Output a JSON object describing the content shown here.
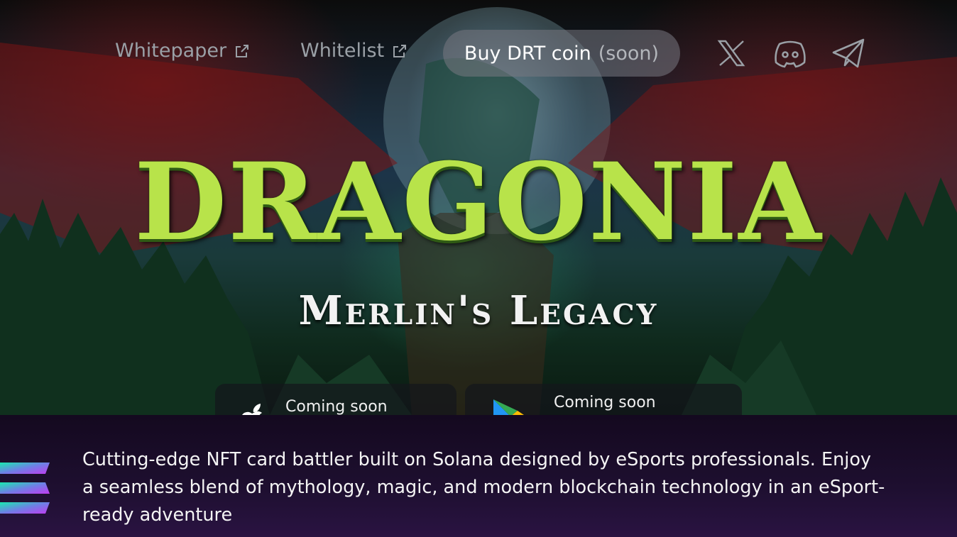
{
  "nav": {
    "whitepaper_label": "Whitepaper",
    "whitelist_label": "Whitelist",
    "buy_label": "Buy DRT coin",
    "buy_soon": "(soon)",
    "social_icons": [
      "x-icon",
      "discord-icon",
      "telegram-icon"
    ]
  },
  "hero": {
    "title": "DRAGONIA",
    "subtitle": "Merlin's Legacy"
  },
  "stores": {
    "apple_label": "Coming soon",
    "google_label": "Coming soon",
    "apple_icon": "apple-icon",
    "google_icon": "google-play-icon"
  },
  "description": {
    "line1": "Cutting-edge NFT card battler built on Solana designed by eSports professionals. Enjoy",
    "line2": "a seamless blend of mythology, magic, and modern blockchain technology in an eSport-",
    "line3": "ready adventure",
    "logo_icon": "solana-icon"
  },
  "colors": {
    "title": "#b8e34a",
    "accent_bg": "#1e0f30",
    "nav_text": "#9aa0a6"
  }
}
